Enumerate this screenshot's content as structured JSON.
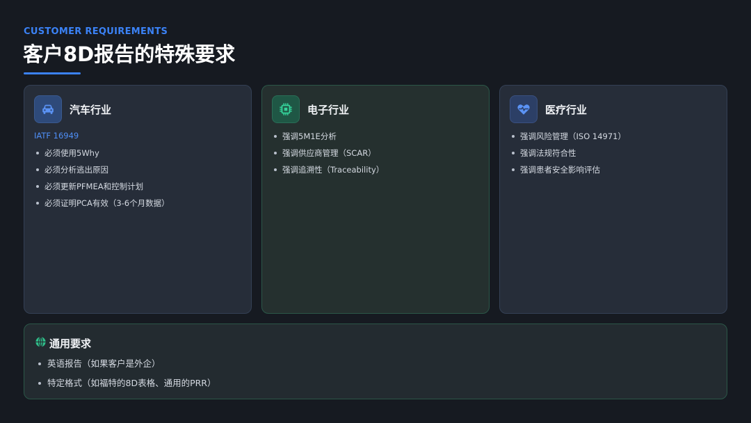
{
  "header": {
    "eyebrow": "CUSTOMER REQUIREMENTS",
    "title": "客户8D报告的特殊要求"
  },
  "cards": [
    {
      "title": "汽车行业",
      "icon": "car-icon",
      "standard": "IATF 16949",
      "items": [
        "必须使用5Why",
        "必须分析逃出原因",
        "必须更新PFMEA和控制计划",
        "必须证明PCA有效（3-6个月数据）"
      ]
    },
    {
      "title": "电子行业",
      "icon": "chip-icon",
      "items": [
        "强调5M1E分析",
        "强调供应商管理（SCAR）",
        "强调追溯性（Traceability）"
      ]
    },
    {
      "title": "医疗行业",
      "icon": "heart-pulse-icon",
      "items": [
        "强调风险管理（ISO 14971）",
        "强调法规符合性",
        "强调患者安全影响评估"
      ]
    }
  ],
  "general": {
    "title": "通用要求",
    "icon": "globe-icon",
    "items": [
      "英语报告（如果客户是外企）",
      "特定格式（如福特的8D表格、通用的PRR）"
    ]
  },
  "colors": {
    "accent": "#3b82f6",
    "green_accent": "#2fbf8a",
    "background": "#161a21",
    "card": "#262d39"
  }
}
